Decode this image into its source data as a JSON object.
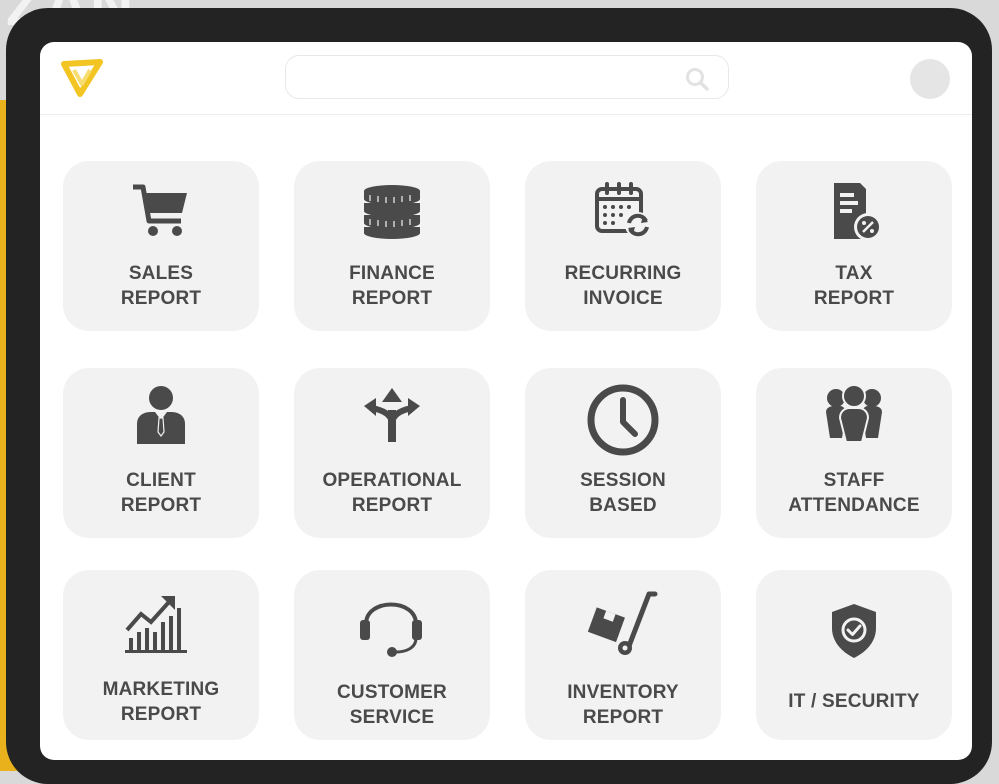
{
  "background": {
    "text": "ZAN"
  },
  "search": {
    "placeholder": "",
    "value": ""
  },
  "colors": {
    "logo": "#f2c522",
    "tile_bg": "#f2f2f2",
    "icon": "#4a4a4a",
    "frame": "#232323",
    "side_band": "#e9b21d"
  },
  "tiles": [
    {
      "icon": "cart-icon",
      "line1": "SALES",
      "line2": "REPORT"
    },
    {
      "icon": "coins-stack-icon",
      "line1": "FINANCE",
      "line2": "REPORT"
    },
    {
      "icon": "calendar-recurring-icon",
      "line1": "RECURRING",
      "line2": "INVOICE"
    },
    {
      "icon": "tax-document-icon",
      "line1": "TAX",
      "line2": "REPORT"
    },
    {
      "icon": "businessman-icon",
      "line1": "CLIENT",
      "line2": "REPORT"
    },
    {
      "icon": "branching-arrows-icon",
      "line1": "OPERATIONAL",
      "line2": "REPORT"
    },
    {
      "icon": "clock-icon",
      "line1": "SESSION",
      "line2": "BASED"
    },
    {
      "icon": "team-icon",
      "line1": "STAFF",
      "line2": "ATTENDANCE"
    },
    {
      "icon": "growth-chart-icon",
      "line1": "MARKETING",
      "line2": "REPORT"
    },
    {
      "icon": "headset-icon",
      "line1": "CUSTOMER",
      "line2": "SERVICE"
    },
    {
      "icon": "hand-truck-icon",
      "line1": "INVENTORY",
      "line2": "REPORT"
    },
    {
      "icon": "shield-check-icon",
      "line1": "IT / SECURITY",
      "line2": ""
    }
  ]
}
